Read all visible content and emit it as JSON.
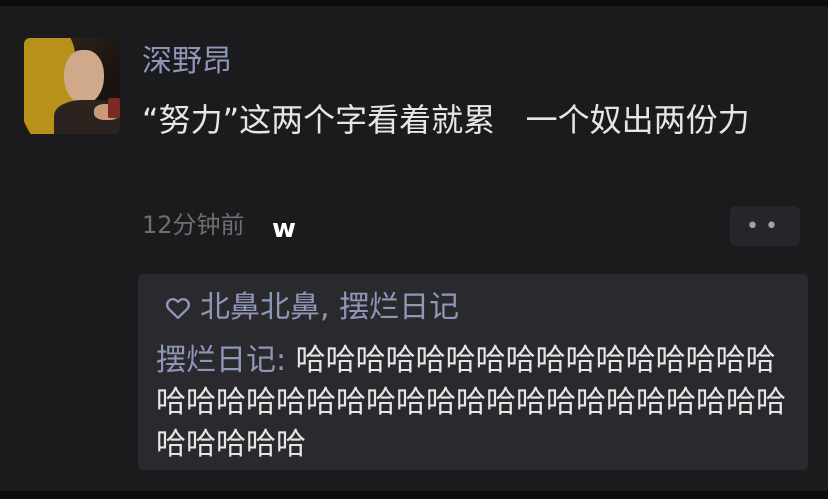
{
  "post": {
    "author": "深野昂",
    "content": "“努力”这两个字看着就累   一个奴出两份力",
    "time": "12分钟前",
    "time_overlay_mark": "w",
    "more_button": "••"
  },
  "interactions": {
    "likes_names": "北鼻北鼻, 摆烂日记",
    "comment": {
      "author": "摆烂日记:",
      "text": " 哈哈哈哈哈哈哈哈哈哈哈哈哈哈哈哈哈哈哈哈哈哈哈哈哈哈哈哈哈哈哈哈哈哈哈哈哈哈哈哈哈哈"
    }
  }
}
